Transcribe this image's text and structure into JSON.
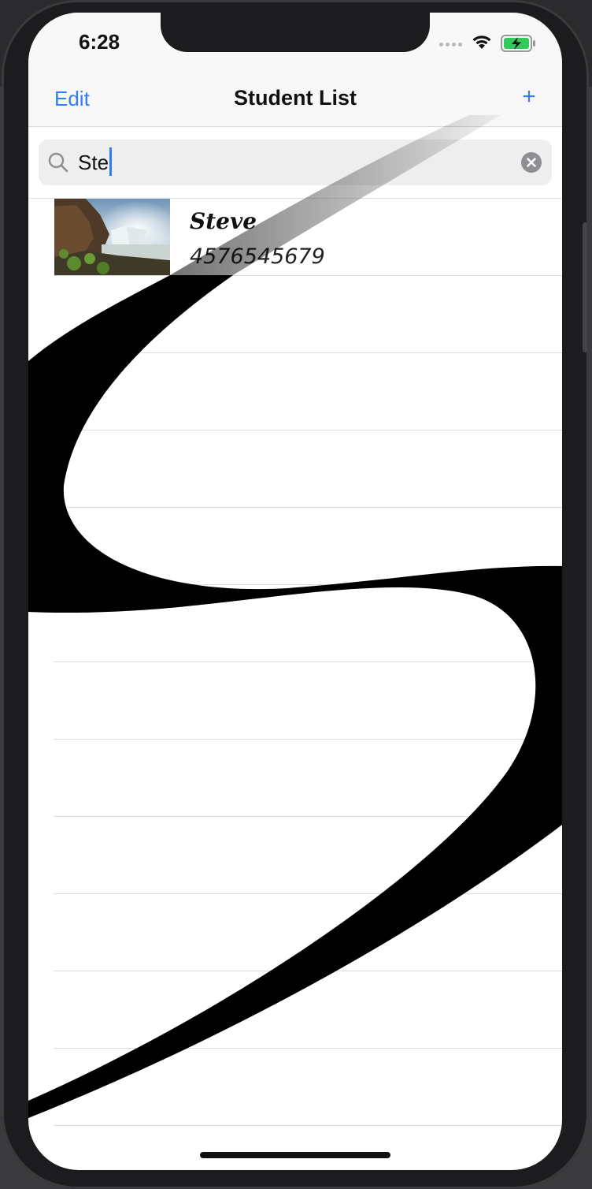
{
  "status_bar": {
    "time": "6:28",
    "icons": [
      "cellular-dots-icon",
      "wifi-icon",
      "battery-charging-icon"
    ]
  },
  "nav": {
    "edit_label": "Edit",
    "title": "Student List",
    "add_label": "+"
  },
  "search": {
    "value": "Ste",
    "icon": "search-icon",
    "clear_icon": "clear-icon"
  },
  "students": [
    {
      "name": "Steve",
      "phone": "4576545679",
      "photo": "waterfall-photo"
    }
  ],
  "colors": {
    "accent": "#2f7cf6",
    "nav_bg": "#f8f8f8",
    "separator": "#dcdcde"
  }
}
